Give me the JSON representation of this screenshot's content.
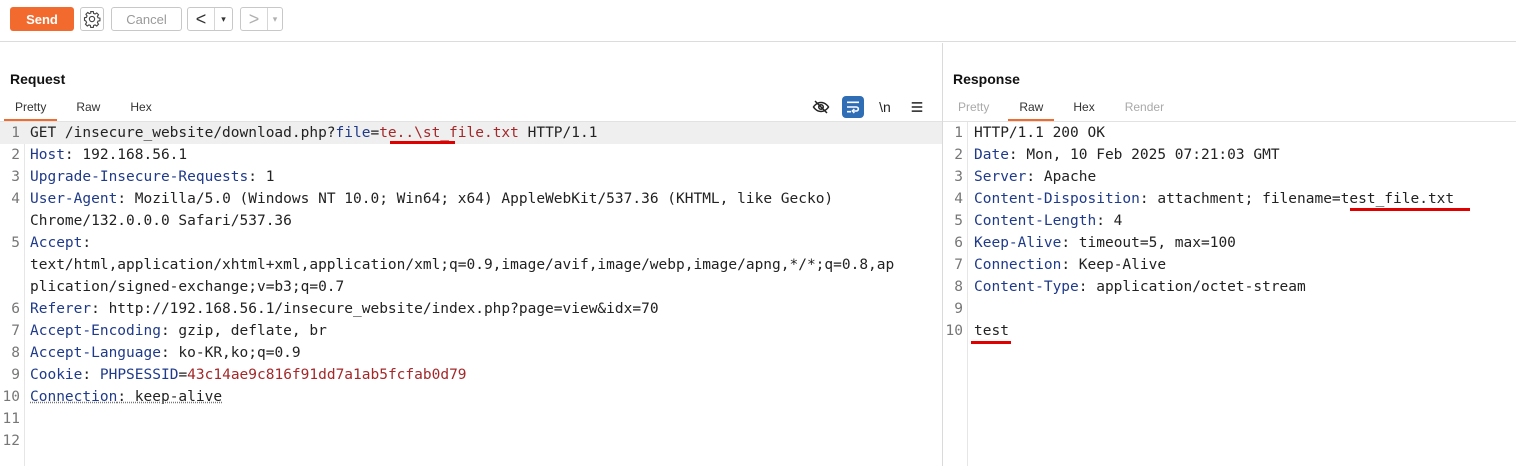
{
  "toolbar": {
    "send_label": "Send",
    "cancel_label": "Cancel",
    "back_label": "<",
    "forward_label": ">",
    "dropdown_glyph": "▾",
    "accent_color": "#f26a2e"
  },
  "request": {
    "title": "Request",
    "tabs": [
      "Pretty",
      "Raw",
      "Hex"
    ],
    "active_tab": "Pretty",
    "icons": [
      "hide-icon",
      "wrap-lines-icon",
      "newline-icon",
      "menu-icon"
    ],
    "newline_label": "\\n",
    "lines": [
      {
        "n": "1",
        "segments": [
          {
            "t": "GET /insecure_website/download.php?"
          },
          {
            "t": "file",
            "c": "param"
          },
          {
            "t": "="
          },
          {
            "t": "te..\\st_file.txt",
            "c": "red"
          },
          {
            "t": " HTTP/1.1"
          }
        ]
      },
      {
        "n": "2",
        "segments": [
          {
            "t": "Host",
            "c": "k"
          },
          {
            "t": ": 192.168.56.1"
          }
        ]
      },
      {
        "n": "3",
        "segments": [
          {
            "t": "Upgrade-Insecure-Requests",
            "c": "k"
          },
          {
            "t": ": 1"
          }
        ]
      },
      {
        "n": "4",
        "segments": [
          {
            "t": "User-Agent",
            "c": "k"
          },
          {
            "t": ": Mozilla/5.0 (Windows NT 10.0; Win64; x64) AppleWebKit/537.36 (KHTML, like Gecko)\nChrome/132.0.0.0 Safari/537.36"
          }
        ]
      },
      {
        "n": "5",
        "segments": [
          {
            "t": "Accept",
            "c": "k"
          },
          {
            "t": ":\ntext/html,application/xhtml+xml,application/xml;q=0.9,image/avif,image/webp,image/apng,*/*;q=0.8,ap\nplication/signed-exchange;v=b3;q=0.7"
          }
        ]
      },
      {
        "n": "6",
        "segments": [
          {
            "t": "Referer",
            "c": "k"
          },
          {
            "t": ": http://192.168.56.1/insecure_website/index.php?page=view&idx=70"
          }
        ]
      },
      {
        "n": "7",
        "segments": [
          {
            "t": "Accept-Encoding",
            "c": "k"
          },
          {
            "t": ": gzip, deflate, br"
          }
        ]
      },
      {
        "n": "8",
        "segments": [
          {
            "t": "Accept-Language",
            "c": "k"
          },
          {
            "t": ": ko-KR,ko;q=0.9"
          }
        ]
      },
      {
        "n": "9",
        "segments": [
          {
            "t": "Cookie",
            "c": "k"
          },
          {
            "t": ": "
          },
          {
            "t": "PHPSESSID",
            "c": "param"
          },
          {
            "t": "="
          },
          {
            "t": "43c14ae9c816f91dd7a1ab5fcfab0d79",
            "c": "red"
          }
        ]
      },
      {
        "n": "10",
        "segments": [
          {
            "t": "Connection",
            "c": "k ul"
          },
          {
            "t": ": keep-alive",
            "c": "ul"
          }
        ]
      },
      {
        "n": "11",
        "segments": []
      },
      {
        "n": "12",
        "segments": []
      }
    ]
  },
  "response": {
    "title": "Response",
    "tabs": [
      "Pretty",
      "Raw",
      "Hex",
      "Render"
    ],
    "active_tab": "Raw",
    "lines": [
      {
        "n": "1",
        "segments": [
          {
            "t": "HTTP/1.1 200 OK"
          }
        ]
      },
      {
        "n": "2",
        "segments": [
          {
            "t": "Date",
            "c": "k"
          },
          {
            "t": ": Mon, 10 Feb 2025 07:21:03 GMT"
          }
        ]
      },
      {
        "n": "3",
        "segments": [
          {
            "t": "Server",
            "c": "k"
          },
          {
            "t": ": Apache"
          }
        ]
      },
      {
        "n": "4",
        "segments": [
          {
            "t": "Content-Disposition",
            "c": "k"
          },
          {
            "t": ": attachment; filename=test_file.txt"
          }
        ]
      },
      {
        "n": "5",
        "segments": [
          {
            "t": "Content-Length",
            "c": "k"
          },
          {
            "t": ": 4"
          }
        ]
      },
      {
        "n": "6",
        "segments": [
          {
            "t": "Keep-Alive",
            "c": "k"
          },
          {
            "t": ": timeout=5, max=100"
          }
        ]
      },
      {
        "n": "7",
        "segments": [
          {
            "t": "Connection",
            "c": "k"
          },
          {
            "t": ": Keep-Alive"
          }
        ]
      },
      {
        "n": "8",
        "segments": [
          {
            "t": "Content-Type",
            "c": "k"
          },
          {
            "t": ": application/octet-stream"
          }
        ]
      },
      {
        "n": "9",
        "segments": []
      },
      {
        "n": "10",
        "segments": [
          {
            "t": "test"
          }
        ]
      }
    ]
  }
}
